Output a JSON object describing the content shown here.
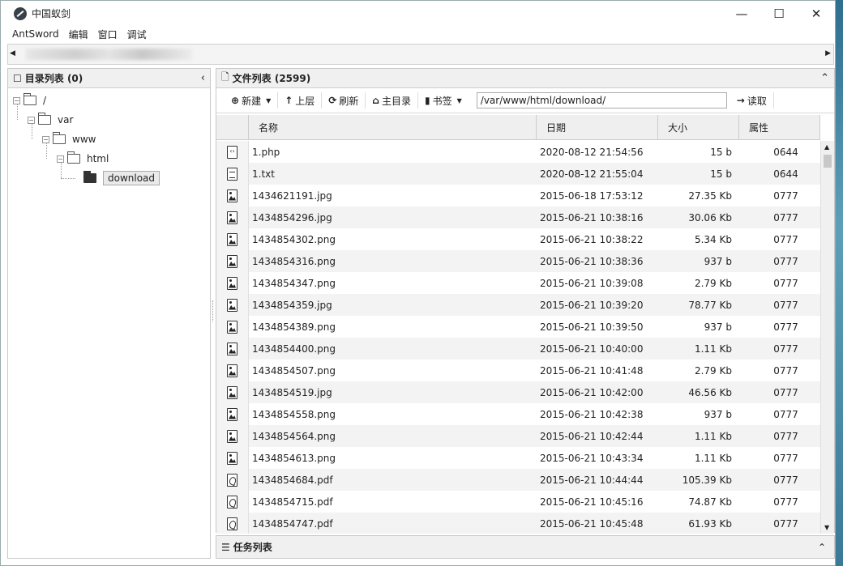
{
  "window": {
    "title": "中国蚁剑",
    "controls": [
      "—",
      "☐",
      "✕"
    ]
  },
  "menu": [
    "AntSword",
    "编辑",
    "窗口",
    "调试"
  ],
  "dir_panel": {
    "title": "目录列表 (0)"
  },
  "tree": {
    "root": "/",
    "var": "var",
    "www": "www",
    "html": "html",
    "download": "download"
  },
  "file_panel": {
    "title": "文件列表 (2599)"
  },
  "toolbar": {
    "new": "新建",
    "up": "上层",
    "refresh": "刷新",
    "home": "主目录",
    "bookmark": "书签",
    "path": "/var/www/html/download/",
    "read": "读取"
  },
  "columns": [
    "名称",
    "日期",
    "大小",
    "属性"
  ],
  "files": [
    {
      "icon": "code",
      "name": "1.php",
      "date": "2020-08-12 21:54:56",
      "size": "15 b",
      "attr": "0644"
    },
    {
      "icon": "txt",
      "name": "1.txt",
      "date": "2020-08-12 21:55:04",
      "size": "15 b",
      "attr": "0644"
    },
    {
      "icon": "img",
      "name": "1434621191.jpg",
      "date": "2015-06-18 17:53:12",
      "size": "27.35 Kb",
      "attr": "0777"
    },
    {
      "icon": "img",
      "name": "1434854296.jpg",
      "date": "2015-06-21 10:38:16",
      "size": "30.06 Kb",
      "attr": "0777"
    },
    {
      "icon": "img",
      "name": "1434854302.png",
      "date": "2015-06-21 10:38:22",
      "size": "5.34 Kb",
      "attr": "0777"
    },
    {
      "icon": "img",
      "name": "1434854316.png",
      "date": "2015-06-21 10:38:36",
      "size": "937 b",
      "attr": "0777"
    },
    {
      "icon": "img",
      "name": "1434854347.png",
      "date": "2015-06-21 10:39:08",
      "size": "2.79 Kb",
      "attr": "0777"
    },
    {
      "icon": "img",
      "name": "1434854359.jpg",
      "date": "2015-06-21 10:39:20",
      "size": "78.77 Kb",
      "attr": "0777"
    },
    {
      "icon": "img",
      "name": "1434854389.png",
      "date": "2015-06-21 10:39:50",
      "size": "937 b",
      "attr": "0777"
    },
    {
      "icon": "img",
      "name": "1434854400.png",
      "date": "2015-06-21 10:40:00",
      "size": "1.11 Kb",
      "attr": "0777"
    },
    {
      "icon": "img",
      "name": "1434854507.png",
      "date": "2015-06-21 10:41:48",
      "size": "2.79 Kb",
      "attr": "0777"
    },
    {
      "icon": "img",
      "name": "1434854519.jpg",
      "date": "2015-06-21 10:42:00",
      "size": "46.56 Kb",
      "attr": "0777"
    },
    {
      "icon": "img",
      "name": "1434854558.png",
      "date": "2015-06-21 10:42:38",
      "size": "937 b",
      "attr": "0777"
    },
    {
      "icon": "img",
      "name": "1434854564.png",
      "date": "2015-06-21 10:42:44",
      "size": "1.11 Kb",
      "attr": "0777"
    },
    {
      "icon": "img",
      "name": "1434854613.png",
      "date": "2015-06-21 10:43:34",
      "size": "1.11 Kb",
      "attr": "0777"
    },
    {
      "icon": "pdf",
      "name": "1434854684.pdf",
      "date": "2015-06-21 10:44:44",
      "size": "105.39 Kb",
      "attr": "0777"
    },
    {
      "icon": "pdf",
      "name": "1434854715.pdf",
      "date": "2015-06-21 10:45:16",
      "size": "74.87 Kb",
      "attr": "0777"
    },
    {
      "icon": "pdf",
      "name": "1434854747.pdf",
      "date": "2015-06-21 10:45:48",
      "size": "61.93 Kb",
      "attr": "0777"
    }
  ],
  "task_panel": {
    "title": "任务列表"
  }
}
